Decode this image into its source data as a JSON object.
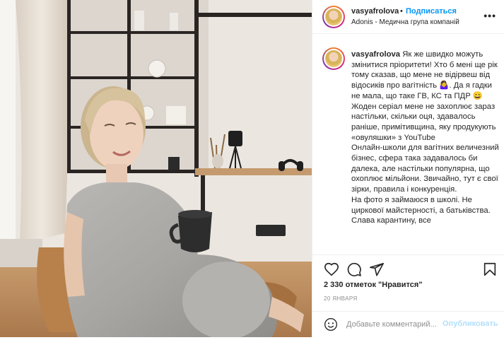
{
  "post": {
    "username": "vasyafrolova",
    "dot": "•",
    "follow_label": "Подписаться",
    "location": "Adonis - Медична група компаній",
    "more_label": "•••",
    "caption": {
      "username": "vasyafrolova",
      "text_1": "Як же швидко можуть змінитися пріоритети! Хто б мені ще рік тому сказав, що мене не відірвеш від відосиків про вагітність 🤷‍♀️. Да я гадки не мала, що таке ГВ, КС та ПДР 😄",
      "text_2": "Жоден серіал мене не захоплює зараз настільки, скільки оця, здавалось раніше, примітивщина, яку продукують «овуляшки» з YouTube",
      "text_3": "Онлайн-школи для вагітних величезний бізнес, сфера така задавалось би далека, але настільки популярна, що охоплює мільйони. Звичайно, тут є свої зірки, правила і конкуренція.",
      "text_4": "На фото я займаюся в школі. Не циркової майстерності, а батьківства. Слава карантину, все"
    },
    "likes": "2 330 отметок \"Нравится\"",
    "date": "20 ЯНВАРЯ",
    "comment_placeholder": "Добавьте комментарий...",
    "publish_label": "Опубликовать"
  },
  "icons": {
    "like": "heart-icon",
    "comment": "comment-icon",
    "share": "paper-plane-icon",
    "save": "bookmark-icon",
    "emoji": "smiley-icon"
  },
  "colors": {
    "accent": "#0095f6",
    "publish_disabled": "#b2dffc",
    "muted": "#8e8e8e",
    "text": "#262626",
    "border": "#efefef"
  }
}
